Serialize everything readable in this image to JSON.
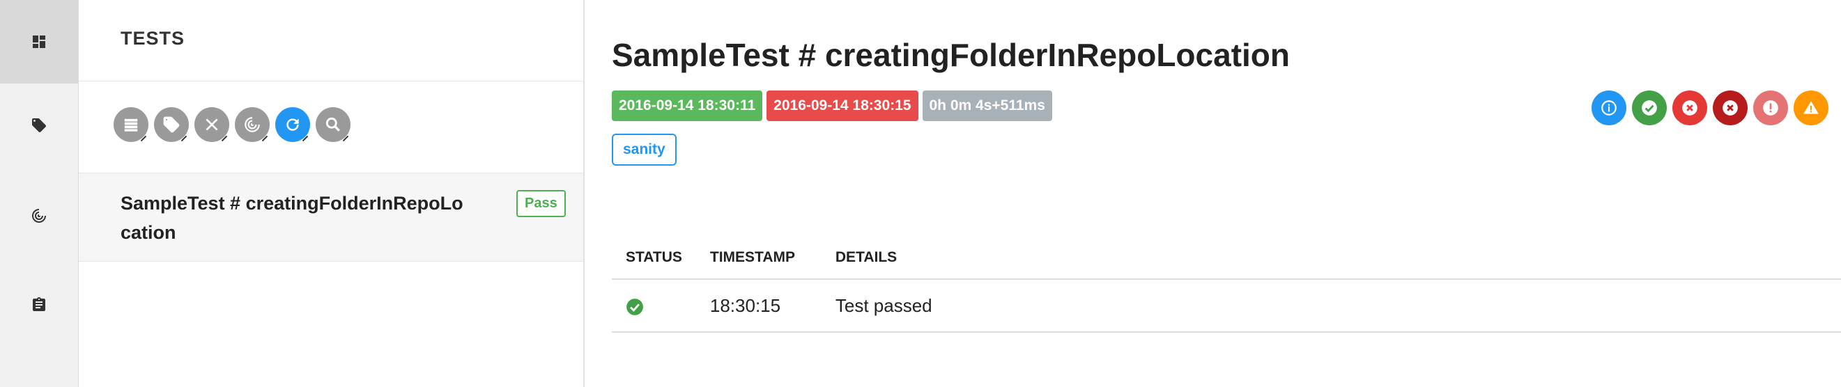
{
  "sidebar": {
    "items": [
      {
        "icon": "dashboard-icon",
        "active": true
      },
      {
        "icon": "tag-icon",
        "active": false
      },
      {
        "icon": "radar-icon",
        "active": false
      },
      {
        "icon": "clipboard-icon",
        "active": false
      }
    ]
  },
  "tests_panel": {
    "title": "TESTS",
    "filters": [
      {
        "icon": "list-icon"
      },
      {
        "icon": "tag-icon"
      },
      {
        "icon": "close-icon"
      },
      {
        "icon": "radar-icon"
      },
      {
        "icon": "refresh-icon",
        "active": true
      },
      {
        "icon": "search-icon"
      }
    ],
    "tests": [
      {
        "name": "SampleTest # creatingFolderInRepoLocation",
        "status": "Pass"
      }
    ]
  },
  "detail": {
    "title": "SampleTest # creatingFolderInRepoLocation",
    "start_time": "2016-09-14 18:30:11",
    "end_time": "2016-09-14 18:30:15",
    "duration": "0h 0m 4s+511ms",
    "category": "sanity",
    "status_filters": [
      {
        "icon": "info-icon",
        "color": "#2196f3"
      },
      {
        "icon": "check-icon",
        "color": "#43a047"
      },
      {
        "icon": "fail-icon",
        "color": "#e53935"
      },
      {
        "icon": "fatal-icon",
        "color": "#b71c1c"
      },
      {
        "icon": "error-icon",
        "color": "#e57373"
      },
      {
        "icon": "warning-icon",
        "color": "#ff9800"
      }
    ],
    "log": {
      "headers": [
        "STATUS",
        "TIMESTAMP",
        "DETAILS"
      ],
      "rows": [
        {
          "status_icon": "check-circle-icon",
          "status_color": "#43a047",
          "timestamp": "18:30:15",
          "details": "Test passed"
        }
      ]
    }
  },
  "colors": {
    "pass": "#4caf50",
    "fail": "#e84b4b",
    "accent": "#2196f3"
  }
}
